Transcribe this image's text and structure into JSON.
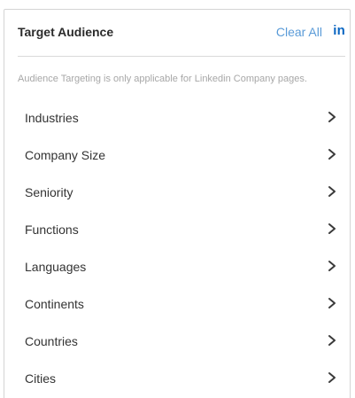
{
  "panel": {
    "title": "Target Audience",
    "clear_all_label": "Clear All",
    "network_icon_text": "in",
    "notice": "Audience Targeting is only applicable for Linkedin Company pages."
  },
  "audience_items": [
    {
      "label": "Industries",
      "icon": "chevron-right-icon"
    },
    {
      "label": "Company Size",
      "icon": "chevron-right-icon"
    },
    {
      "label": "Seniority",
      "icon": "chevron-right-icon"
    },
    {
      "label": "Functions",
      "icon": "chevron-right-icon"
    },
    {
      "label": "Languages",
      "icon": "chevron-right-icon"
    },
    {
      "label": "Continents",
      "icon": "chevron-right-icon"
    },
    {
      "label": "Countries",
      "icon": "chevron-right-icon"
    },
    {
      "label": "Cities",
      "icon": "chevron-right-icon"
    }
  ],
  "colors": {
    "accent_link": "#5a9bd8",
    "linkedin_brand": "#0a66c2",
    "notice_text": "#a7a7a7"
  }
}
